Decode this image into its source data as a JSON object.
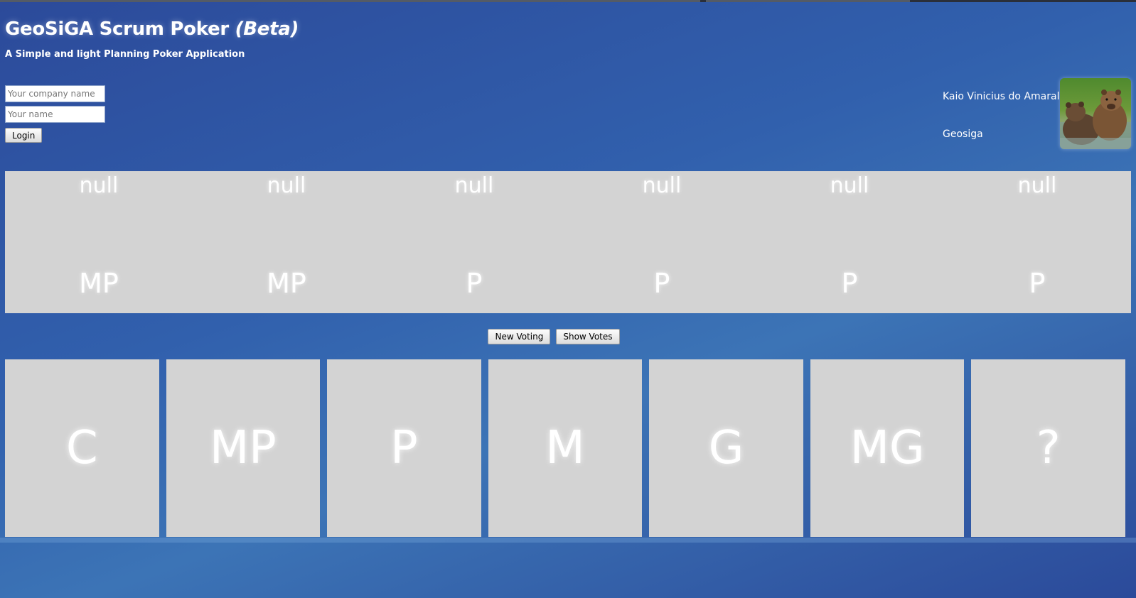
{
  "header": {
    "title": "GeoSiGA Scrum Poker",
    "title_suffix": "(Beta)",
    "subtitle": "A Simple and light Planning Poker Application"
  },
  "login": {
    "company_placeholder": "Your company name",
    "name_placeholder": "Your name",
    "login_label": "Login"
  },
  "user": {
    "name": "Kaio Vinicius do Amaral",
    "company": "Geosiga",
    "avatar": "bear-photo"
  },
  "votes": [
    {
      "voter": "null",
      "value": "MP"
    },
    {
      "voter": "null",
      "value": "MP"
    },
    {
      "voter": "null",
      "value": "P"
    },
    {
      "voter": "null",
      "value": "P"
    },
    {
      "voter": "null",
      "value": "P"
    },
    {
      "voter": "null",
      "value": "P"
    }
  ],
  "actions": {
    "new_voting_label": "New Voting",
    "show_votes_label": "Show Votes"
  },
  "cards": [
    "C",
    "MP",
    "P",
    "M",
    "G",
    "MG",
    "?"
  ],
  "colors": {
    "background": "#3160ad",
    "panel": "#d3d3d3",
    "text": "#ffffff"
  }
}
